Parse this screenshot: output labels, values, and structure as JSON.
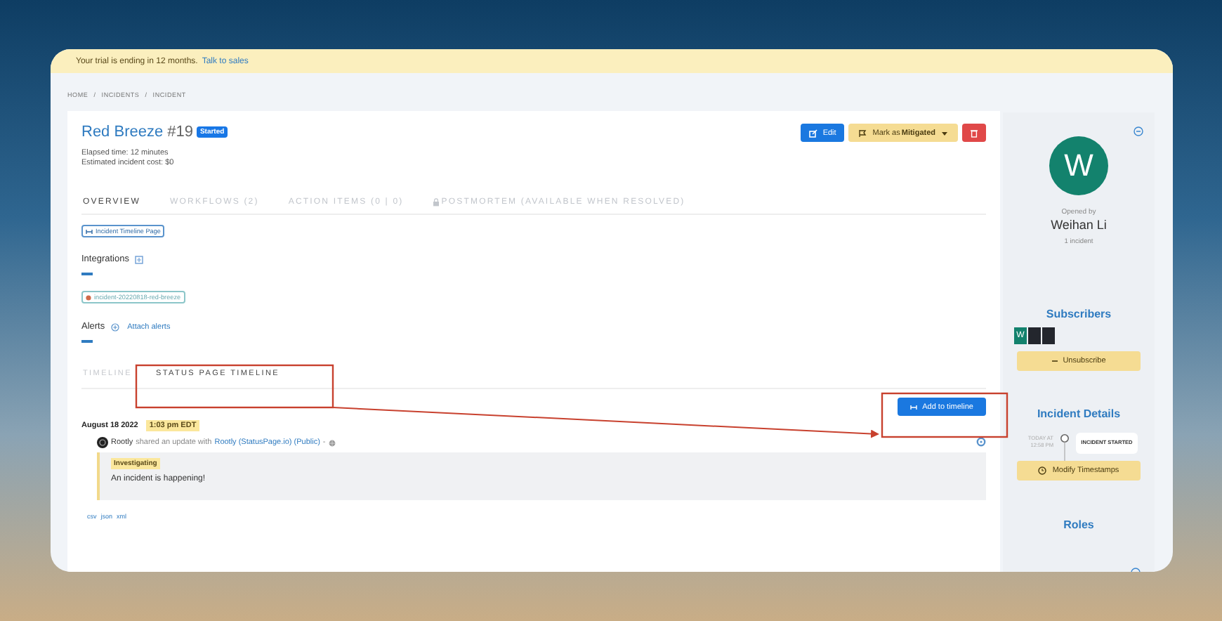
{
  "banner": {
    "text": "Your trial is ending in 12 months.",
    "link": "Talk to sales"
  },
  "breadcrumb": {
    "items": [
      "HOME",
      "INCIDENTS",
      "INCIDENT"
    ],
    "separator": "/"
  },
  "incident": {
    "title": "Red Breeze",
    "number": "#19",
    "status": "Started",
    "elapsed": "Elapsed time: 12 minutes",
    "cost": "Estimated incident cost: $0"
  },
  "actions": {
    "edit": "Edit",
    "mark_prefix": "Mark as",
    "mark_state": "Mitigated"
  },
  "tabs": [
    {
      "label": "OVERVIEW",
      "selected": true,
      "locked": false
    },
    {
      "label": "WORKFLOWS (2)",
      "selected": false,
      "locked": false
    },
    {
      "label": "ACTION ITEMS (0 | 0)",
      "selected": false,
      "locked": false
    },
    {
      "label": "POSTMORTEM (AVAILABLE WHEN RESOLVED)",
      "selected": false,
      "locked": true
    }
  ],
  "timeline_page_link": "Incident Timeline Page",
  "integrations": {
    "title": "Integrations",
    "chip": "incident-20220818-red-breeze"
  },
  "alerts": {
    "title": "Alerts",
    "action": "Attach alerts"
  },
  "subtabs": [
    {
      "label": "TIMELINE",
      "selected": false
    },
    {
      "label": "STATUS PAGE TIMELINE",
      "selected": true
    }
  ],
  "add_button": "Add to timeline",
  "entry": {
    "date": "August 18 2022",
    "time": "1:03 pm EDT",
    "author": "Rootly",
    "action": "shared an update with",
    "target": "Rootly (StatusPage.io) (Public)",
    "separator": "-",
    "status": "Investigating",
    "message": "An incident is happening!"
  },
  "exports": [
    "csv",
    "json",
    "xml"
  ],
  "sidebar": {
    "avatar_letter": "W",
    "opened_label": "Opened by",
    "name": "Weihan Li",
    "count": "1 incident",
    "subscribers_title": "Subscribers",
    "subscribers": [
      {
        "letter": "W",
        "color": "#13826d"
      },
      {
        "color": "#23262d"
      },
      {
        "color": "#23262d"
      }
    ],
    "unsubscribe": "Unsubscribe",
    "details_title": "Incident Details",
    "event_time": "TODAY AT 12:58 PM",
    "event_label": "INCIDENT STARTED",
    "modify": "Modify Timestamps",
    "roles_title": "Roles"
  }
}
